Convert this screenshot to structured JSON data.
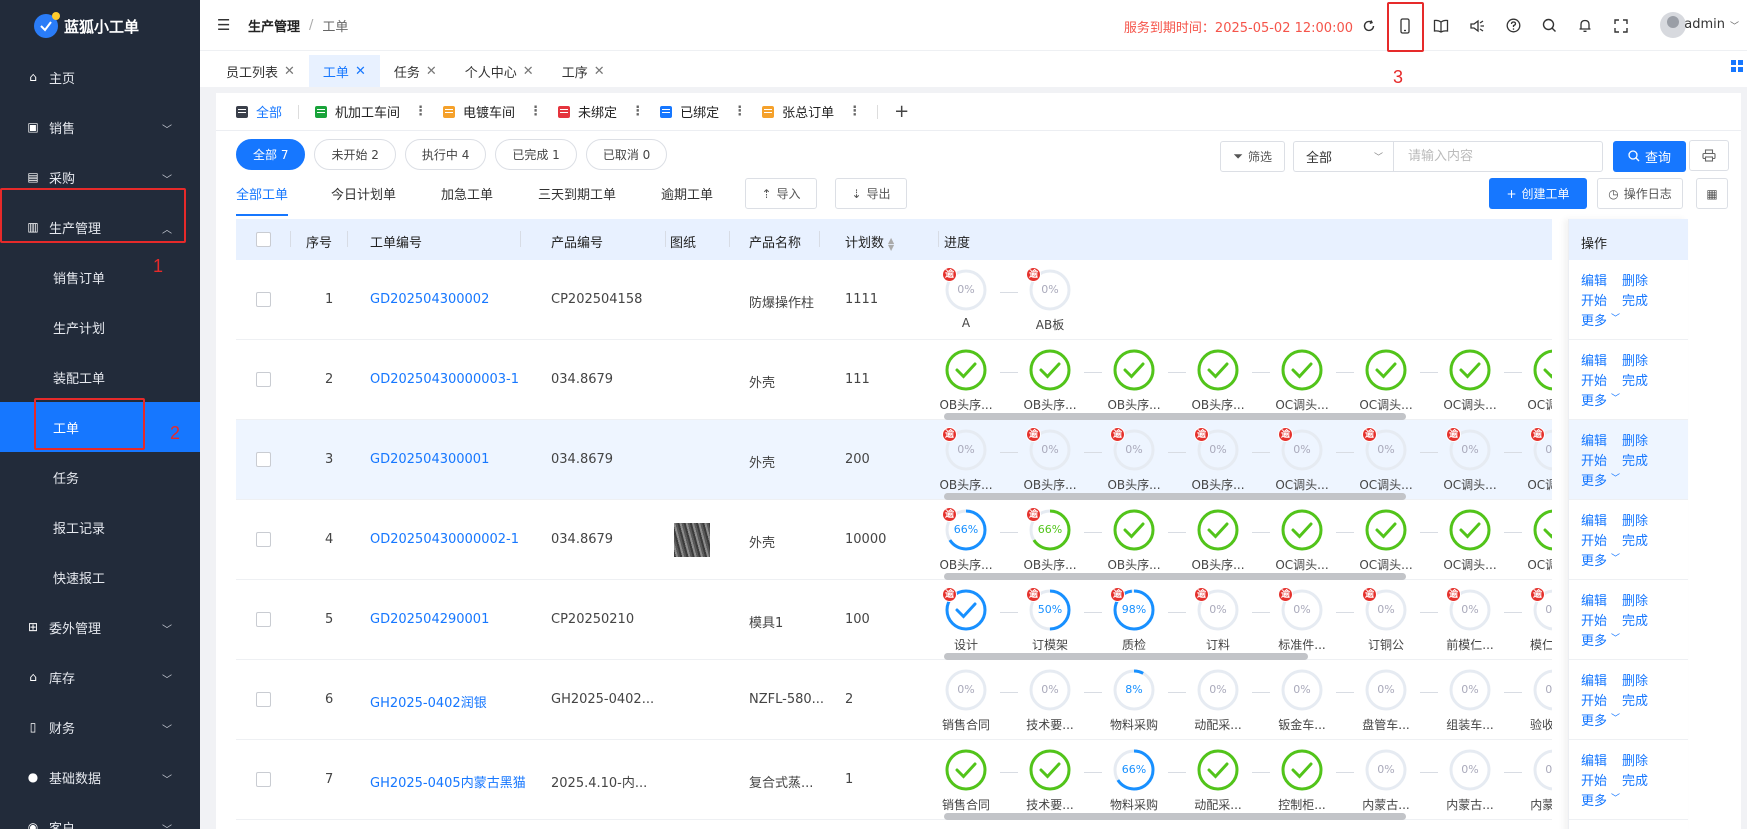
{
  "app": {
    "name": "蓝狐小工单"
  },
  "sidebar": {
    "items": [
      {
        "label": "主页",
        "icon": "home-icon"
      },
      {
        "label": "销售",
        "icon": "bag-icon"
      },
      {
        "label": "采购",
        "icon": "cart-icon"
      },
      {
        "label": "生产管理",
        "icon": "factory-icon"
      },
      {
        "label": "委外管理",
        "icon": "outsource-icon"
      },
      {
        "label": "库存",
        "icon": "warehouse-icon"
      },
      {
        "label": "财务",
        "icon": "finance-icon"
      },
      {
        "label": "基础数据",
        "icon": "info-icon"
      },
      {
        "label": "客户",
        "icon": "customer-icon"
      }
    ],
    "sub_items": [
      {
        "label": "销售订单"
      },
      {
        "label": "生产计划"
      },
      {
        "label": "装配工单"
      },
      {
        "label": "工单"
      },
      {
        "label": "任务"
      },
      {
        "label": "报工记录"
      },
      {
        "label": "快速报工"
      }
    ]
  },
  "header": {
    "breadcrumb": [
      "生产管理",
      "工单"
    ],
    "expiry": "服务到期时间：2025-05-02 12:00:00",
    "icons": [
      "refresh-icon",
      "mobile-icon",
      "book-icon",
      "speaker-icon",
      "help-icon",
      "search-icon",
      "bell-icon",
      "fullscreen-icon"
    ],
    "user": "admin"
  },
  "tags": [
    {
      "label": "员工列表"
    },
    {
      "label": "工单"
    },
    {
      "label": "任务"
    },
    {
      "label": "个人中心"
    },
    {
      "label": "工序"
    }
  ],
  "view_tabs": [
    {
      "label": "全部",
      "color": "#3a3f4a"
    },
    {
      "label": "机加工车间",
      "color": "#19a33a"
    },
    {
      "label": "电镀车间",
      "color": "#f5a12b"
    },
    {
      "label": "未绑定",
      "color": "#e5343d"
    },
    {
      "label": "已绑定",
      "color": "#1677ff"
    },
    {
      "label": "张总订单",
      "color": "#f5a12b"
    }
  ],
  "status_pills": [
    {
      "label": "全部 7"
    },
    {
      "label": "未开始 2"
    },
    {
      "label": "执行中 4"
    },
    {
      "label": "已完成 1"
    },
    {
      "label": "已取消 0"
    }
  ],
  "filter": {
    "filter_label": "筛选",
    "select_value": "全部",
    "search_placeholder": "请输入内容",
    "query_label": "查询"
  },
  "sub_tabs": [
    {
      "label": "全部工单"
    },
    {
      "label": "今日计划单"
    },
    {
      "label": "加急工单"
    },
    {
      "label": "三天到期工单"
    },
    {
      "label": "逾期工单"
    }
  ],
  "actions": {
    "import": "导入",
    "export": "导出",
    "create": "创建工单",
    "log": "操作日志"
  },
  "table": {
    "columns": [
      "序号",
      "工单编号",
      "产品编号",
      "图纸",
      "产品名称",
      "计划数",
      "进度",
      "操作"
    ],
    "overdue_mark": "逾",
    "ops": {
      "edit": "编辑",
      "delete": "删除",
      "start": "开始",
      "finish": "完成",
      "more": "更多"
    },
    "rows": [
      {
        "seq": "1",
        "order_no": "GD202504300002",
        "product_no": "CP202504158",
        "has_drawing": false,
        "product_name": "防爆操作柱",
        "qty": "1111",
        "scroll_width": 0,
        "steps": [
          {
            "label": "A",
            "pct": 0,
            "done": false,
            "overdue": true,
            "pct_text": "0%"
          },
          {
            "label": "AB板",
            "pct": 0,
            "done": false,
            "overdue": true,
            "pct_text": "0%"
          }
        ]
      },
      {
        "seq": "2",
        "order_no": "OD20250430000003-1",
        "product_no": "034.8679",
        "has_drawing": false,
        "product_name": "外壳",
        "qty": "111",
        "scroll_width": 0.66,
        "steps": [
          {
            "label": "OB头序...",
            "pct": 100,
            "done": true,
            "overdue": false,
            "pct_text": ""
          },
          {
            "label": "OB头序...",
            "pct": 100,
            "done": true,
            "overdue": false,
            "pct_text": ""
          },
          {
            "label": "OB头序...",
            "pct": 100,
            "done": true,
            "overdue": false,
            "pct_text": ""
          },
          {
            "label": "OB头序...",
            "pct": 100,
            "done": true,
            "overdue": false,
            "pct_text": ""
          },
          {
            "label": "OC调头...",
            "pct": 100,
            "done": true,
            "overdue": false,
            "pct_text": ""
          },
          {
            "label": "OC调头...",
            "pct": 100,
            "done": true,
            "overdue": false,
            "pct_text": ""
          },
          {
            "label": "OC调头...",
            "pct": 100,
            "done": true,
            "overdue": false,
            "pct_text": ""
          },
          {
            "label": "OC调头...",
            "pct": 100,
            "done": true,
            "overdue": false,
            "pct_text": ""
          }
        ]
      },
      {
        "seq": "3",
        "order_no": "GD202504300001",
        "product_no": "034.8679",
        "has_drawing": false,
        "product_name": "外壳",
        "qty": "200",
        "scroll_width": 0.66,
        "steps": [
          {
            "label": "OB头序...",
            "pct": 0,
            "done": false,
            "overdue": true,
            "pct_text": "0%"
          },
          {
            "label": "OB头序...",
            "pct": 0,
            "done": false,
            "overdue": true,
            "pct_text": "0%"
          },
          {
            "label": "OB头序...",
            "pct": 0,
            "done": false,
            "overdue": true,
            "pct_text": "0%"
          },
          {
            "label": "OB头序...",
            "pct": 0,
            "done": false,
            "overdue": true,
            "pct_text": "0%"
          },
          {
            "label": "OC调头...",
            "pct": 0,
            "done": false,
            "overdue": true,
            "pct_text": "0%"
          },
          {
            "label": "OC调头...",
            "pct": 0,
            "done": false,
            "overdue": true,
            "pct_text": "0%"
          },
          {
            "label": "OC调头...",
            "pct": 0,
            "done": false,
            "overdue": true,
            "pct_text": "0%"
          },
          {
            "label": "OC调头...",
            "pct": 0,
            "done": false,
            "overdue": true,
            "pct_text": "0%"
          }
        ]
      },
      {
        "seq": "4",
        "order_no": "OD20250430000002-1",
        "product_no": "034.8679",
        "has_drawing": true,
        "product_name": "外壳",
        "qty": "10000",
        "scroll_width": 0.66,
        "steps": [
          {
            "label": "OB头序...",
            "pct": 66,
            "done": false,
            "overdue": true,
            "pct_text": "66%",
            "color": "#1890ff"
          },
          {
            "label": "OB头序...",
            "pct": 66,
            "done": false,
            "overdue": true,
            "pct_text": "66%",
            "color": "#52c41a"
          },
          {
            "label": "OB头序...",
            "pct": 100,
            "done": true,
            "overdue": false,
            "pct_text": ""
          },
          {
            "label": "OB头序...",
            "pct": 100,
            "done": true,
            "overdue": false,
            "pct_text": ""
          },
          {
            "label": "OC调头...",
            "pct": 100,
            "done": true,
            "overdue": false,
            "pct_text": ""
          },
          {
            "label": "OC调头...",
            "pct": 100,
            "done": true,
            "overdue": false,
            "pct_text": ""
          },
          {
            "label": "OC调头...",
            "pct": 100,
            "done": true,
            "overdue": false,
            "pct_text": ""
          },
          {
            "label": "OC调头...",
            "pct": 100,
            "done": true,
            "overdue": false,
            "pct_text": ""
          }
        ]
      },
      {
        "seq": "5",
        "order_no": "GD202504290001",
        "product_no": "CP20250210",
        "has_drawing": false,
        "product_name": "模具1",
        "qty": "100",
        "scroll_width": 0.52,
        "steps": [
          {
            "label": "设计",
            "pct": 100,
            "done": true,
            "overdue": true,
            "pct_text": "",
            "color": "#1890ff"
          },
          {
            "label": "订模架",
            "pct": 50,
            "done": false,
            "overdue": true,
            "pct_text": "50%",
            "color": "#1890ff"
          },
          {
            "label": "质检",
            "pct": 98,
            "done": false,
            "overdue": true,
            "pct_text": "98%",
            "color": "#1890ff"
          },
          {
            "label": "订料",
            "pct": 0,
            "done": false,
            "overdue": true,
            "pct_text": "0%"
          },
          {
            "label": "标准件...",
            "pct": 0,
            "done": false,
            "overdue": true,
            "pct_text": "0%"
          },
          {
            "label": "订铜公",
            "pct": 0,
            "done": false,
            "overdue": true,
            "pct_text": "0%"
          },
          {
            "label": "前模仁...",
            "pct": 0,
            "done": false,
            "overdue": true,
            "pct_text": "0%"
          },
          {
            "label": "模仁放电",
            "pct": 0,
            "done": false,
            "overdue": true,
            "pct_text": "0%"
          }
        ]
      },
      {
        "seq": "6",
        "order_no": "GH2025-0402润银",
        "product_no": "GH2025-0402...",
        "has_drawing": false,
        "product_name": "NZFL-580...",
        "qty": "2",
        "scroll_width": 0,
        "steps": [
          {
            "label": "销售合同",
            "pct": 0,
            "done": false,
            "overdue": false,
            "pct_text": "0%"
          },
          {
            "label": "技术要...",
            "pct": 0,
            "done": false,
            "overdue": false,
            "pct_text": "0%"
          },
          {
            "label": "物料采购",
            "pct": 8,
            "done": false,
            "overdue": false,
            "pct_text": "8%",
            "color": "#1890ff"
          },
          {
            "label": "动配采...",
            "pct": 0,
            "done": false,
            "overdue": false,
            "pct_text": "0%"
          },
          {
            "label": "钣金车...",
            "pct": 0,
            "done": false,
            "overdue": false,
            "pct_text": "0%"
          },
          {
            "label": "盘管车...",
            "pct": 0,
            "done": false,
            "overdue": false,
            "pct_text": "0%"
          },
          {
            "label": "组装车...",
            "pct": 0,
            "done": false,
            "overdue": false,
            "pct_text": "0%"
          },
          {
            "label": "验收发货",
            "pct": 0,
            "done": false,
            "overdue": false,
            "pct_text": "0%"
          }
        ]
      },
      {
        "seq": "7",
        "order_no": "GH2025-0405内蒙古黑猫",
        "product_no": "2025.4.10-内...",
        "has_drawing": false,
        "product_name": "复合式蒸...",
        "qty": "1",
        "scroll_width": 0.66,
        "steps": [
          {
            "label": "销售合同",
            "pct": 100,
            "done": true,
            "overdue": false,
            "pct_text": ""
          },
          {
            "label": "技术要...",
            "pct": 100,
            "done": true,
            "overdue": false,
            "pct_text": ""
          },
          {
            "label": "物料采购",
            "pct": 66,
            "done": false,
            "overdue": false,
            "pct_text": "66%",
            "color": "#1890ff"
          },
          {
            "label": "动配采...",
            "pct": 100,
            "done": true,
            "overdue": false,
            "pct_text": ""
          },
          {
            "label": "控制柜...",
            "pct": 100,
            "done": true,
            "overdue": false,
            "pct_text": ""
          },
          {
            "label": "内蒙古...",
            "pct": 0,
            "done": false,
            "overdue": false,
            "pct_text": "0%"
          },
          {
            "label": "内蒙古...",
            "pct": 0,
            "done": false,
            "overdue": false,
            "pct_text": "0%"
          },
          {
            "label": "内蒙古...",
            "pct": 0,
            "done": false,
            "overdue": false,
            "pct_text": "0%"
          }
        ]
      }
    ]
  },
  "annotations": [
    {
      "label": "1"
    },
    {
      "label": "2"
    },
    {
      "label": "3"
    }
  ],
  "colors": {
    "accent": "#1677ff",
    "sidebar_bg": "#222b3a",
    "done_green": "#52c41a",
    "progress_blue": "#1890ff",
    "overdue_red": "#e5322d",
    "annotation_red": "#e62a2a"
  }
}
